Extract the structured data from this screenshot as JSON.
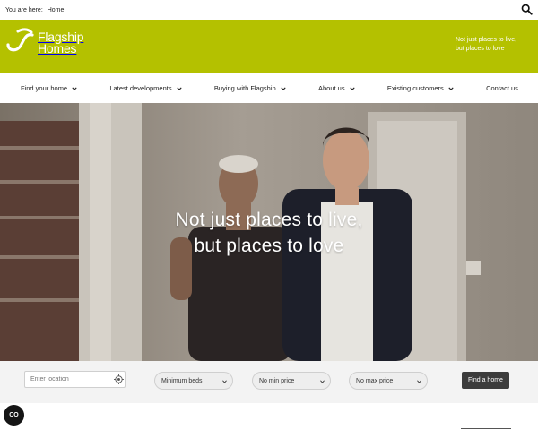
{
  "topbar": {
    "breadcrumb_label": "You are here:",
    "breadcrumb_home": "Home"
  },
  "brand": {
    "logo_line1": "Flagship",
    "logo_line2": "Homes",
    "tagline_line1": "Not just places to live,",
    "tagline_line2": "but places to love",
    "color": "#b4c100"
  },
  "nav": {
    "items": [
      {
        "label": "Find your home"
      },
      {
        "label": "Latest developments"
      },
      {
        "label": "Buying with Flagship"
      },
      {
        "label": "About us"
      },
      {
        "label": "Existing customers"
      },
      {
        "label": "Contact us"
      }
    ]
  },
  "hero": {
    "line1": "Not just places to live,",
    "line2": "but places to love"
  },
  "search": {
    "location_placeholder": "Enter location",
    "beds": "Minimum beds",
    "min_price": "No min price",
    "max_price": "No max price",
    "button": "Find a home"
  },
  "cookie": {
    "label": "CO"
  }
}
